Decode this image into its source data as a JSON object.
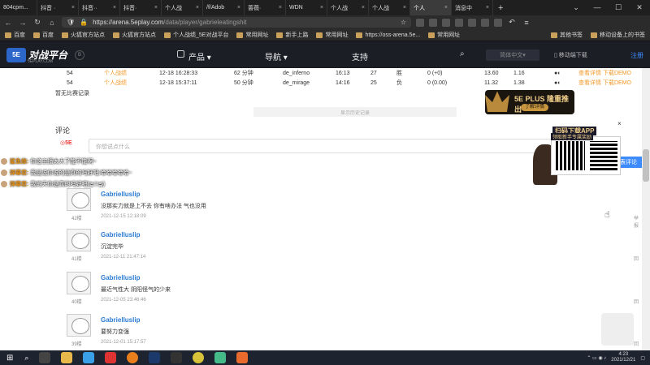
{
  "browser": {
    "tabs": [
      "804cpm...",
      "抖音 ·",
      "抖音··",
      "抖音·",
      "个人战",
      "/f/Adob",
      "蔷薇·",
      "WDN",
      "个人战",
      "个人战",
      "个人",
      "消息中"
    ],
    "active_tab_index": 10,
    "url_host": "https://arena.5eplay.com",
    "url_path": "/data/player/gabrieleatingshit",
    "bookmarks": [
      "百度",
      "百度",
      "火狐官方站点",
      "火狐官方站点",
      "个人战绩_5E对战平台",
      "常用网址",
      "新手上路",
      "常用网址",
      "https://oss-arena.5e...",
      "常用网址"
    ],
    "bookmarks_right": [
      "其他书签",
      "移动设备上的书签"
    ]
  },
  "site": {
    "logo_text": "对战平台",
    "logo_sub": "5EPLAY.COM",
    "logo_badge": "5E",
    "bell": "B",
    "nav": [
      "产品",
      "导航",
      "支持"
    ],
    "lang": "简体中文",
    "mobile": "移动端下载",
    "register": "注册"
  },
  "matches": [
    {
      "idx": "54",
      "mode": "个人战绩",
      "time": "12-18 16:28:33",
      "dur": "62 分钟",
      "map": "de_inferno",
      "score": "16:13",
      "kills": "27",
      "result": "胜",
      "elo": "0 (+0)",
      "rating": "13.60",
      "adr": "1.16",
      "actions": "查看详情 下载DEMO"
    },
    {
      "idx": "54",
      "mode": "个人战绩",
      "time": "12-18 15:37:11",
      "dur": "50 分钟",
      "map": "de_mirage",
      "score": "14:16",
      "kills": "25",
      "result": "负",
      "elo": "0 (0.00)",
      "rating": "11.32",
      "adr": "1.38",
      "actions": "查看详情 下载DEMO"
    }
  ],
  "no_record": "暂无比赛记录",
  "history_btn": "显示历史记录",
  "comments_title": "评论",
  "comment_placeholder": "你想说点什么",
  "post_btn": "发表评论",
  "comments": [
    {
      "user": "Gabrielluslip",
      "text": "没那实力就是上不去 你有啥办法 气也没用",
      "time": "2021-12-15 12:18:09",
      "floor": "42楼",
      "reply": "举报"
    },
    {
      "user": "Gabrielluslip",
      "text": "沉淀完毕",
      "time": "2021-12-11 21:47:14",
      "floor": "41楼",
      "reply": "回"
    },
    {
      "user": "Gabrielluslip",
      "text": "最近气性大 阴阳怪气的少来",
      "time": "2021-12-05 23:46:46",
      "floor": "40楼",
      "reply": "回"
    },
    {
      "user": "Gabrielluslip",
      "text": "要努力变强",
      "time": "2021-12-01 15:17:57",
      "floor": "39楼",
      "reply": "回"
    }
  ],
  "danmu": [
    {
      "name": "鲨鱼娘:",
      "msg": "你这主播太大了能不能啊~"
    },
    {
      "name": "弹幕君:",
      "msg": "我是说你说的是真的吗好吧,哈哈哈哈哈~"
    },
    {
      "name": "弹幕君:",
      "msg": "我的天你是真的吗好吧(≧▽≦)"
    }
  ],
  "promo": {
    "title": "5E PLUS 隆重推出",
    "btn": "了解详情"
  },
  "qr": {
    "title": "扫码下载APP",
    "sub": "领取新手专属奖励",
    "close": "×"
  },
  "clock": {
    "time": "4:23",
    "date": "2021/12/21"
  }
}
